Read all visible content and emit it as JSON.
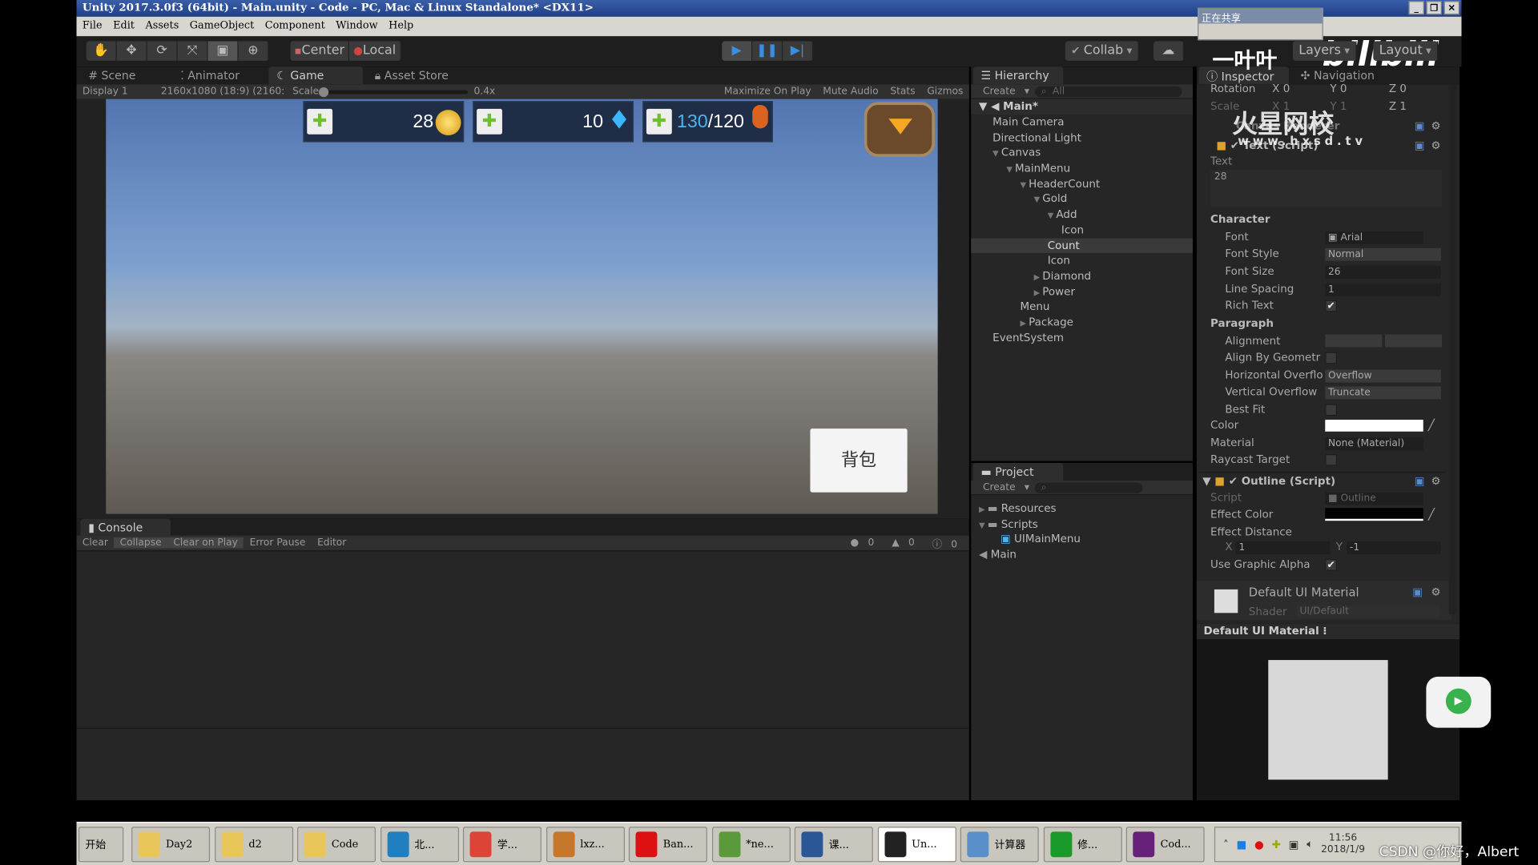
{
  "window": {
    "title": "Unity 2017.3.0f3 (64bit) - Main.unity - Code - PC, Mac & Linux Standalone* <DX11>"
  },
  "menu": [
    "File",
    "Edit",
    "Assets",
    "GameObject",
    "Component",
    "Window",
    "Help"
  ],
  "toolbar": {
    "center": "Center",
    "local": "Local",
    "collab": "Collab",
    "layers": "Layers",
    "layout": "Layout"
  },
  "tabs": {
    "scene": "Scene",
    "animator": "Animator",
    "game": "Game",
    "asset_store": "Asset Store"
  },
  "game_bar": {
    "display": "Display 1",
    "resolution": "2160x1080 (18:9) (2160:",
    "scale_label": "Scale",
    "scale_value": "0.4x",
    "maximize": "Maximize On Play",
    "mute": "Mute Audio",
    "stats": "Stats",
    "gizmos": "Gizmos"
  },
  "game": {
    "gold": "28",
    "diamond": "10",
    "power_current": "130",
    "power_max": "/120",
    "bag_button": "背包",
    "power_color": "#4fb3e8"
  },
  "console": {
    "tab": "Console",
    "clear": "Clear",
    "collapse": "Collapse",
    "clear_on_play": "Clear on Play",
    "error_pause": "Error Pause",
    "editor": "Editor",
    "errors": "0",
    "warnings": "0",
    "logs": "0"
  },
  "hierarchy": {
    "tab": "Hierarchy",
    "create": "Create",
    "search_placeholder": "All",
    "scene": "Main*",
    "items": [
      {
        "label": "Main Camera",
        "depth": 0,
        "arrow": ""
      },
      {
        "label": "Directional Light",
        "depth": 0,
        "arrow": ""
      },
      {
        "label": "Canvas",
        "depth": 0,
        "arrow": "▼"
      },
      {
        "label": "MainMenu",
        "depth": 1,
        "arrow": "▼"
      },
      {
        "label": "HeaderCount",
        "depth": 2,
        "arrow": "▼"
      },
      {
        "label": "Gold",
        "depth": 3,
        "arrow": "▼"
      },
      {
        "label": "Add",
        "depth": 4,
        "arrow": "▼"
      },
      {
        "label": "Icon",
        "depth": 5,
        "arrow": ""
      },
      {
        "label": "Count",
        "depth": 4,
        "arrow": "",
        "selected": true
      },
      {
        "label": "Icon",
        "depth": 4,
        "arrow": ""
      },
      {
        "label": "Diamond",
        "depth": 3,
        "arrow": "▶"
      },
      {
        "label": "Power",
        "depth": 3,
        "arrow": "▶"
      },
      {
        "label": "Menu",
        "depth": 2,
        "arrow": ""
      },
      {
        "label": "Package",
        "depth": 2,
        "arrow": "▶"
      },
      {
        "label": "EventSystem",
        "depth": 0,
        "arrow": ""
      }
    ]
  },
  "project": {
    "tab": "Project",
    "create": "Create",
    "items": [
      {
        "label": "Resources",
        "depth": 0,
        "arrow": "▶",
        "type": "folder"
      },
      {
        "label": "Scripts",
        "depth": 0,
        "arrow": "▼",
        "type": "folder"
      },
      {
        "label": "UIMainMenu",
        "depth": 1,
        "arrow": "",
        "type": "script"
      },
      {
        "label": "Main",
        "depth": 0,
        "arrow": "",
        "type": "scene"
      }
    ]
  },
  "inspector": {
    "tab": "Inspector",
    "nav_tab": "Navigation",
    "rotation": {
      "label": "Rotation",
      "x": "0",
      "y": "0",
      "z": "0"
    },
    "scale": {
      "label": "Scale",
      "x": "1",
      "y": "1",
      "z": "1"
    },
    "canvas_renderer": "Canvas Renderer",
    "text_component": "Text (Script)",
    "text_label": "Text",
    "text_value": "28",
    "character": "Character",
    "font_label": "Font",
    "font": "Arial",
    "font_style_label": "Font Style",
    "font_style": "Normal",
    "font_size_label": "Font Size",
    "font_size": "26",
    "line_spacing_label": "Line Spacing",
    "line_spacing": "1",
    "rich_text_label": "Rich Text",
    "rich_text": true,
    "paragraph": "Paragraph",
    "alignment_label": "Alignment",
    "align_geom_label": "Align By Geometr",
    "h_overflow_label": "Horizontal Overflo",
    "h_overflow": "Overflow",
    "v_overflow_label": "Vertical Overflow",
    "v_overflow": "Truncate",
    "best_fit_label": "Best Fit",
    "color_label": "Color",
    "color": "#ffffff",
    "material_label": "Material",
    "material": "None (Material)",
    "raycast_label": "Raycast Target",
    "outline_component": "Outline (Script)",
    "script_label": "Script",
    "script": "Outline",
    "effect_color_label": "Effect Color",
    "effect_color": "#000000",
    "effect_distance_label": "Effect Distance",
    "ed_x": "1",
    "ed_y": "-1",
    "use_alpha_label": "Use Graphic Alpha",
    "material_name": "Default UI Material",
    "shader_label": "Shader",
    "shader": "UI/Default",
    "preview_title": "Default UI Material"
  },
  "overlay": {
    "sharing": "正在共享",
    "watermark_site": "火星网校",
    "watermark_url": "www.hxsd.tv",
    "uploader": "一叶叶",
    "bilibili": "bilibili",
    "csdn": "CSDN @你好，Albert"
  },
  "taskbar": {
    "start": "开始",
    "items": [
      {
        "label": "Day2",
        "icon": "folder-icon",
        "color": "#e8c65a"
      },
      {
        "label": "d2",
        "icon": "folder-icon",
        "color": "#e8c65a"
      },
      {
        "label": "Code",
        "icon": "folder-icon",
        "color": "#e8c65a"
      },
      {
        "label": "北...",
        "icon": "browser-icon",
        "color": "#1f7fc0"
      },
      {
        "label": "学...",
        "icon": "chrome-icon",
        "color": "#db4437"
      },
      {
        "label": "lxz...",
        "icon": "qq-icon",
        "color": "#c7772c"
      },
      {
        "label": "Ban...",
        "icon": "record-icon",
        "color": "#d11"
      },
      {
        "label": "*ne...",
        "icon": "notepad-icon",
        "color": "#5a9a3a"
      },
      {
        "label": "课...",
        "icon": "word-icon",
        "color": "#2b5797"
      },
      {
        "label": "Un...",
        "icon": "unity-icon",
        "color": "#222",
        "active": true
      },
      {
        "label": "计算器",
        "icon": "calculator-icon",
        "color": "#5b8fc9"
      },
      {
        "label": "修...",
        "icon": "app-icon",
        "color": "#1a9a2a"
      },
      {
        "label": "Cod...",
        "icon": "visual-studio-icon",
        "color": "#68217a"
      }
    ],
    "time": "11:56",
    "date": "2018/1/9"
  }
}
